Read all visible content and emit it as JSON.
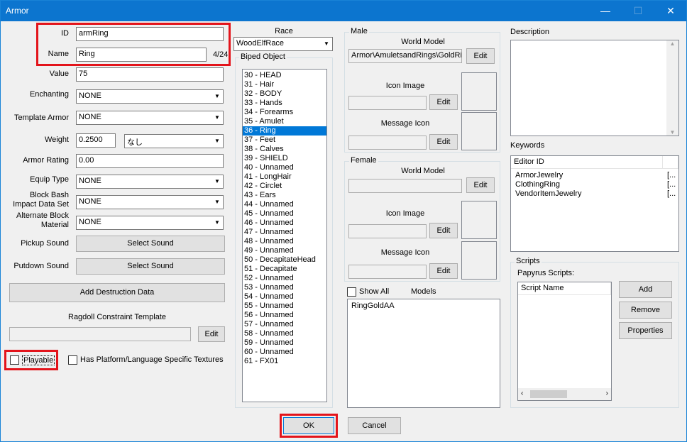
{
  "window": {
    "title": "Armor",
    "minimize": "—",
    "maximize": "☐",
    "close": "✕"
  },
  "left": {
    "id_label": "ID",
    "id_value": "armRing",
    "name_label": "Name",
    "name_value": "Ring",
    "name_count": "4/24",
    "value_label": "Value",
    "value_value": "75",
    "enchanting_label": "Enchanting",
    "enchanting_value": "NONE",
    "template_label": "Template Armor",
    "template_value": "NONE",
    "weight_label": "Weight",
    "weight_value": "0.2500",
    "weight_unit": "なし",
    "rating_label": "Armor Rating",
    "rating_value": "0.00",
    "equip_label": "Equip Type",
    "equip_value": "NONE",
    "block_label_1": "Block Bash",
    "block_label_2": "Impact Data Set",
    "block_value": "NONE",
    "alt_label_1": "Alternate Block",
    "alt_label_2": "Material",
    "alt_value": "NONE",
    "pickup_label": "Pickup Sound",
    "pickup_button": "Select Sound",
    "putdown_label": "Putdown Sound",
    "putdown_button": "Select Sound",
    "destruction_button": "Add Destruction Data",
    "ragdoll_label": "Ragdoll Constraint Template",
    "ragdoll_edit": "Edit",
    "playable_label": "Playable",
    "platform_label": "Has Platform/Language Specific Textures"
  },
  "middle": {
    "race_label": "Race",
    "race_value": "WoodElfRace",
    "biped_label": "Biped Object",
    "biped_items": [
      "30 - HEAD",
      "31 - Hair",
      "32 - BODY",
      "33 - Hands",
      "34 - Forearms",
      "35 - Amulet",
      "36 - Ring",
      "37 - Feet",
      "38 - Calves",
      "39 - SHIELD",
      "40 - Unnamed",
      "41 - LongHair",
      "42 - Circlet",
      "43 - Ears",
      "44 - Unnamed",
      "45 - Unnamed",
      "46 - Unnamed",
      "47 - Unnamed",
      "48 - Unnamed",
      "49 - Unnamed",
      "50 - DecapitateHead",
      "51 - Decapitate",
      "52 - Unnamed",
      "53 - Unnamed",
      "54 - Unnamed",
      "55 - Unnamed",
      "56 - Unnamed",
      "57 - Unnamed",
      "58 - Unnamed",
      "59 - Unnamed",
      "60 - Unnamed",
      "61 - FX01"
    ],
    "biped_selected": "36 - Ring"
  },
  "male": {
    "title": "Male",
    "world_model_label": "World Model",
    "world_model_value": "Armor\\AmuletsandRings\\GoldRir",
    "edit": "Edit",
    "icon_image_label": "Icon Image",
    "message_icon_label": "Message Icon"
  },
  "female": {
    "title": "Female",
    "world_model_label": "World Model",
    "edit": "Edit",
    "icon_image_label": "Icon Image",
    "message_icon_label": "Message Icon"
  },
  "models": {
    "show_all": "Show All",
    "label": "Models",
    "items": [
      "RingGoldAA"
    ]
  },
  "right": {
    "description_label": "Description",
    "keywords_label": "Keywords",
    "keywords_header": "Editor ID",
    "keywords": [
      {
        "id": "ArmorJewelry",
        "extra": "[..."
      },
      {
        "id": "ClothingRing",
        "extra": "[..."
      },
      {
        "id": "VendorItemJewelry",
        "extra": "[..."
      }
    ],
    "scripts_title": "Scripts",
    "papyrus_label": "Papyrus Scripts:",
    "script_header": "Script Name",
    "add": "Add",
    "remove": "Remove",
    "properties": "Properties"
  },
  "footer": {
    "ok": "OK",
    "cancel": "Cancel"
  }
}
